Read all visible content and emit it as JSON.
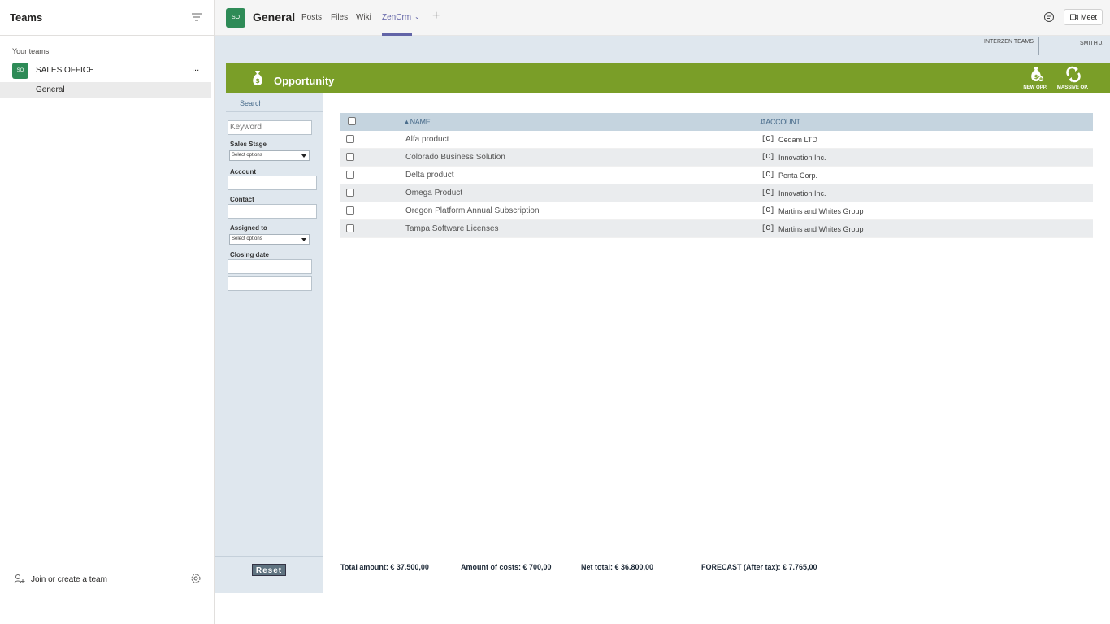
{
  "left_pane": {
    "title": "Teams",
    "your_teams_label": "Your teams",
    "team": {
      "avatar": "SO",
      "name": "SALES OFFICE",
      "more": "..."
    },
    "channel": "General",
    "join_label": "Join or create a team"
  },
  "channel_header": {
    "avatar": "SO",
    "name": "General",
    "tabs": [
      "Posts",
      "Files",
      "Wiki",
      "ZenCrm"
    ],
    "active_tab": "ZenCrm",
    "meet_label": "Meet"
  },
  "app": {
    "org_label": "INTERZEN TEAMS",
    "user_label": "SMITH J.",
    "module_title": "Opportunity",
    "actions": {
      "new_opp": "NEW OPP.",
      "massive_op": "MASSIVE OP."
    },
    "search": {
      "header": "Search",
      "keyword_placeholder": "Keyword",
      "sales_stage_label": "Sales Stage",
      "sales_stage_value": "Select options",
      "account_label": "Account",
      "contact_label": "Contact",
      "assigned_label": "Assigned to",
      "assigned_value": "Select options",
      "closing_label": "Closing date",
      "reset_label": "Reset"
    },
    "table": {
      "col_name": "NAME",
      "col_account": "ACCOUNT",
      "rows": [
        {
          "name": "Alfa product",
          "tag": "[C]",
          "account": "Cedam LTD"
        },
        {
          "name": "Colorado Business Solution",
          "tag": "[C]",
          "account": "Innovation Inc."
        },
        {
          "name": "Delta product",
          "tag": "[C]",
          "account": "Penta Corp."
        },
        {
          "name": "Omega Product",
          "tag": "[C]",
          "account": "Innovation Inc."
        },
        {
          "name": "Oregon Platform Annual Subscription",
          "tag": "[C]",
          "account": "Martins and Whites Group"
        },
        {
          "name": "Tampa Software Licenses",
          "tag": "[C]",
          "account": "Martins and Whites Group"
        }
      ]
    },
    "totals": {
      "total_amount": "Total amount: € 37.500,00",
      "amount_costs": "Amount of costs: € 700,00",
      "net_total": "Net total: € 36.800,00",
      "forecast": "FORECAST (After tax): € 7.765,00"
    }
  },
  "colors": {
    "brand_green": "#7a9e28",
    "teams_purple": "#6264a7",
    "team_avatar": "#2e8b57"
  }
}
